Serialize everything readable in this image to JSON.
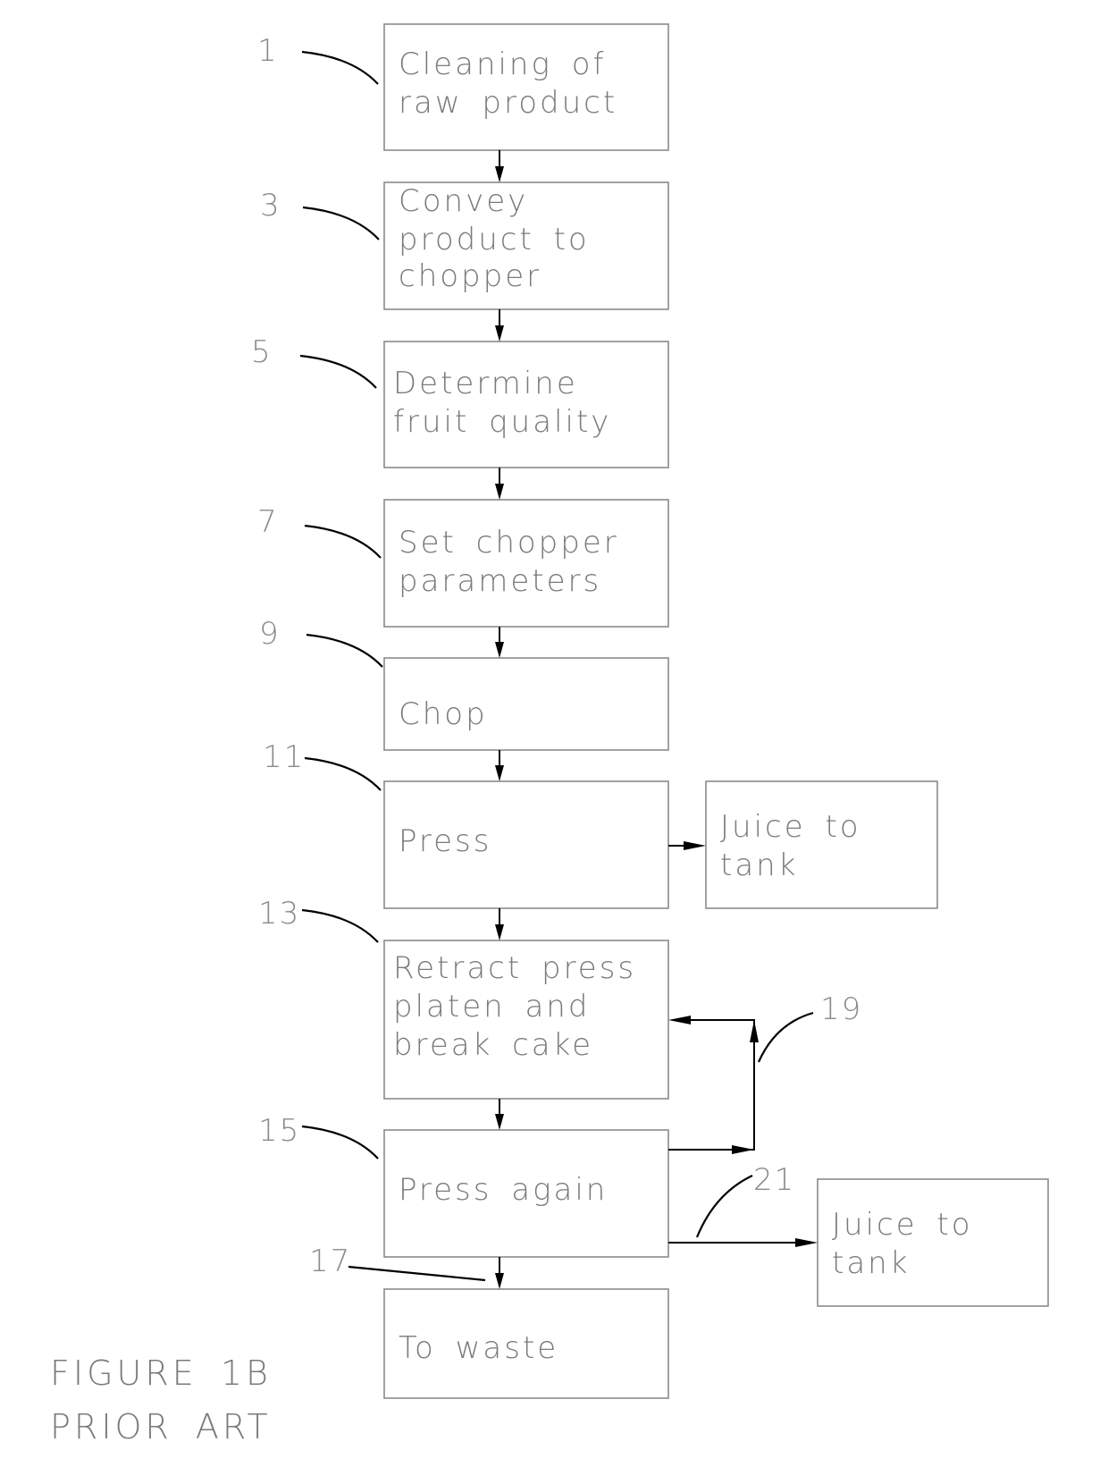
{
  "figure": {
    "caption_line1": "FIGURE 1B",
    "caption_line2": "PRIOR ART"
  },
  "steps": [
    {
      "ref": "1",
      "lines": [
        "Cleaning of",
        "raw product"
      ]
    },
    {
      "ref": "3",
      "lines": [
        "Convey",
        "product to",
        "chopper"
      ]
    },
    {
      "ref": "5",
      "lines": [
        "Determine",
        "fruit quality"
      ]
    },
    {
      "ref": "7",
      "lines": [
        "Set chopper",
        "parameters"
      ]
    },
    {
      "ref": "9",
      "lines": [
        "Chop"
      ]
    },
    {
      "ref": "11",
      "lines": [
        "Press"
      ]
    },
    {
      "ref": "13",
      "lines": [
        "Retract press",
        "platen and",
        "break cake"
      ]
    },
    {
      "ref": "15",
      "lines": [
        "Press again"
      ]
    },
    {
      "ref": "17",
      "lines": [
        "To waste"
      ]
    }
  ],
  "outputs": [
    {
      "from": "Press",
      "lines": [
        "Juice to",
        "tank"
      ]
    },
    {
      "from": "Press again",
      "ref": "21",
      "lines": [
        "Juice to",
        "tank"
      ]
    }
  ],
  "loop": {
    "ref": "19",
    "from": "Press again",
    "to": "Retract press platen and break cake"
  }
}
